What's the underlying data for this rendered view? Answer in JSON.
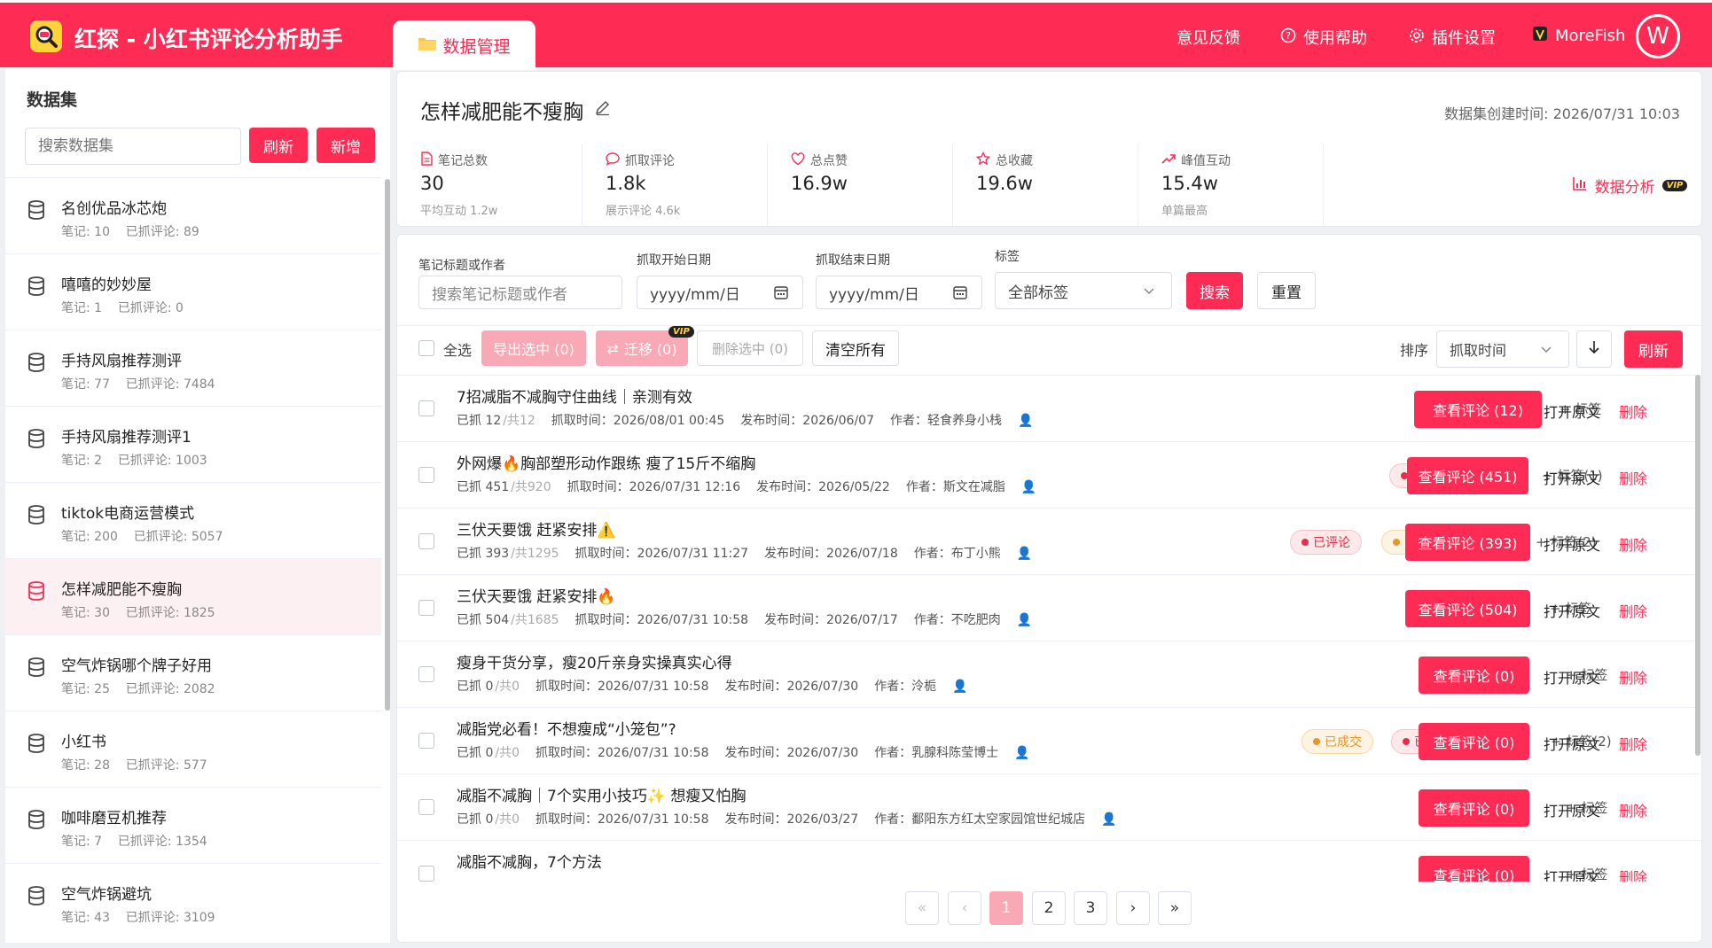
{
  "app": {
    "title": "红探 - 小红书评论分析助手"
  },
  "tabs": [
    {
      "label": "数据管理"
    }
  ],
  "header": {
    "feedback": "意见反馈",
    "help": "使用帮助",
    "settings": "插件设置",
    "user_name": "MoreFish",
    "avatar_letter": "W"
  },
  "sidebar": {
    "title": "数据集",
    "search_placeholder": "搜索数据集",
    "refresh": "刷新",
    "add": "新增",
    "items": [
      {
        "name": "名创优品冰芯炮",
        "notes": "笔记: 10",
        "comments": "已抓评论: 89"
      },
      {
        "name": "嘻嘻的妙妙屋",
        "notes": "笔记: 1",
        "comments": "已抓评论: 0"
      },
      {
        "name": "手持风扇推荐测评",
        "notes": "笔记: 77",
        "comments": "已抓评论: 7484"
      },
      {
        "name": "手持风扇推荐测评1",
        "notes": "笔记: 2",
        "comments": "已抓评论: 1003"
      },
      {
        "name": "tiktok电商运营模式",
        "notes": "笔记: 200",
        "comments": "已抓评论: 5057"
      },
      {
        "name": "怎样减肥能不瘦胸",
        "notes": "笔记: 30",
        "comments": "已抓评论: 1825"
      },
      {
        "name": "空气炸锅哪个牌子好用",
        "notes": "笔记: 25",
        "comments": "已抓评论: 2082"
      },
      {
        "name": "小红书",
        "notes": "笔记: 28",
        "comments": "已抓评论: 577"
      },
      {
        "name": "咖啡磨豆机推荐",
        "notes": "笔记: 7",
        "comments": "已抓评论: 1354"
      },
      {
        "name": "空气炸锅避坑",
        "notes": "笔记: 43",
        "comments": "已抓评论: 3109"
      }
    ]
  },
  "dataset": {
    "title": "怎样减肥能不瘦胸",
    "created": "数据集创建时间: 2026/07/31 10:03",
    "stats": [
      {
        "label": "笔记总数",
        "value": "30",
        "sub": "平均互动 1.2w",
        "icon": "document-icon"
      },
      {
        "label": "抓取评论",
        "value": "1.8k",
        "sub": "展示评论 4.6k",
        "icon": "comment-icon"
      },
      {
        "label": "总点赞",
        "value": "16.9w",
        "sub": "",
        "icon": "heart-icon"
      },
      {
        "label": "总收藏",
        "value": "19.6w",
        "sub": "",
        "icon": "star-icon"
      },
      {
        "label": "峰值互动",
        "value": "15.4w",
        "sub": "单篇最高",
        "icon": "trend-icon"
      }
    ],
    "analysis": "数据分析",
    "vip": "VIP"
  },
  "filters": {
    "title_label": "笔记标题或作者",
    "title_placeholder": "搜索笔记标题或作者",
    "start_label": "抓取开始日期",
    "start_value": "yyyy/mm/日",
    "end_label": "抓取结束日期",
    "end_value": "yyyy/mm/日",
    "tag_label": "标签",
    "tag_value": "全部标签",
    "search": "搜索",
    "reset": "重置"
  },
  "toolbar": {
    "select_all": "全选",
    "export": "导出选中 (0)",
    "migrate": "迁移 (0)",
    "delete_sel": "删除选中 (0)",
    "clear_all": "清空所有",
    "sort_label": "排序",
    "sort_value": "抓取时间",
    "refresh": "刷新"
  },
  "notes": [
    {
      "title": "7招减脂不减胸守住曲线｜亲测有效",
      "grab": "已抓 12",
      "total": "/共12",
      "fetched": "抓取时间：2026/08/01 00:45",
      "published": "发布时间：2026/06/07",
      "author": "作者：轻食养身小栈",
      "tags": [],
      "tag_btn": "+ 标签",
      "view": "查看评论 (12)"
    },
    {
      "title": "外网爆🔥胸部塑形动作跟练 瘦了15斤不缩胸",
      "grab": "已抓 451",
      "total": "/共920",
      "fetched": "抓取时间：2026/07/31 12:16",
      "published": "发布时间：2026/05/22",
      "author": "作者：斯文在减脂",
      "tags": [
        {
          "label": "已评论",
          "color": "red"
        }
      ],
      "tag_btn": "+ 标签(1)",
      "view": "查看评论 (451)"
    },
    {
      "title": "三伏天要饿 赶紧安排⚠️",
      "grab": "已抓 393",
      "total": "/共1295",
      "fetched": "抓取时间：2026/07/31 11:27",
      "published": "发布时间：2026/07/18",
      "author": "作者：布丁小熊",
      "tags": [
        {
          "label": "已评论",
          "color": "red"
        },
        {
          "label": "已成交",
          "color": "yel"
        }
      ],
      "tag_btn": "+ 标签(2)",
      "view": "查看评论 (393)"
    },
    {
      "title": "三伏天要饿 赶紧安排🔥",
      "grab": "已抓 504",
      "total": "/共1685",
      "fetched": "抓取时间：2026/07/31 10:58",
      "published": "发布时间：2026/07/17",
      "author": "作者：不吃肥肉",
      "tags": [],
      "tag_btn": "+ 标签",
      "view": "查看评论 (504)"
    },
    {
      "title": "瘦身干货分享，瘦20斤亲身实操真实心得",
      "grab": "已抓 0",
      "total": "/共0",
      "fetched": "抓取时间：2026/07/31 10:58",
      "published": "发布时间：2026/07/30",
      "author": "作者：泠栀",
      "tags": [],
      "tag_btn": "+ 标签",
      "view": "查看评论 (0)"
    },
    {
      "title": "减脂党必看！不想瘦成“小笼包”?",
      "grab": "已抓 0",
      "total": "/共0",
      "fetched": "抓取时间：2026/07/31 10:58",
      "published": "发布时间：2026/07/30",
      "author": "作者：乳腺科陈莹博士",
      "tags": [
        {
          "label": "已成交",
          "color": "yel"
        },
        {
          "label": "已评论",
          "color": "red"
        }
      ],
      "tag_btn": "+ 标签(2)",
      "view": "查看评论 (0)"
    },
    {
      "title": "减脂不减胸｜7个实用小技巧✨ 想瘦又怕胸",
      "grab": "已抓 0",
      "total": "/共0",
      "fetched": "抓取时间：2026/07/31 10:58",
      "published": "发布时间：2026/03/27",
      "author": "作者：鄱阳东方红太空家园馆世纪城店",
      "tags": [],
      "tag_btn": "+ 标签",
      "view": "查看评论 (0)"
    },
    {
      "title": "减脂不减胸，7个方法",
      "grab": "",
      "total": "",
      "fetched": "",
      "published": "",
      "author": "",
      "tags": [],
      "tag_btn": "+ 标签",
      "view": "查看评论 (0)"
    }
  ],
  "row_actions": {
    "open": "打开原文",
    "delete": "删除"
  },
  "pagination": {
    "first": "«",
    "prev": "‹",
    "pages": [
      "1",
      "2",
      "3"
    ],
    "next": "›",
    "last": "»"
  },
  "colors": {
    "brand": "#fe2c55",
    "pink_disabled": "#f9a8b6"
  }
}
